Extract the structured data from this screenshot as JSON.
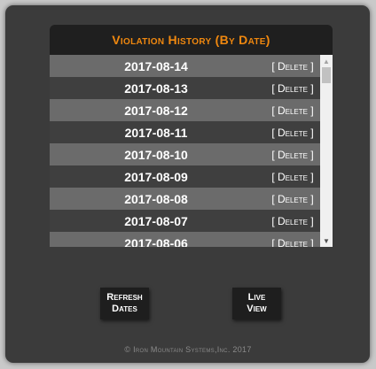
{
  "header": {
    "title": "Violation History (By Date)"
  },
  "dates": [
    "2017-08-14",
    "2017-08-13",
    "2017-08-12",
    "2017-08-11",
    "2017-08-10",
    "2017-08-09",
    "2017-08-08",
    "2017-08-07",
    "2017-08-06"
  ],
  "delete_label": "[ Delete ]",
  "buttons": {
    "refresh_line1": "Refresh",
    "refresh_line2": "Dates",
    "live_line1": "Live",
    "live_line2": "View"
  },
  "footer": {
    "text": "© Iron Mountain Systems,Inc. 2017"
  },
  "colors": {
    "accent": "#f0880f",
    "panel": "#3b3b3b",
    "row_alt": "#6b6b6b",
    "row_norm": "#3f3f3f"
  },
  "icons": [
    "scroll-up-arrow-icon",
    "scroll-down-arrow-icon"
  ]
}
